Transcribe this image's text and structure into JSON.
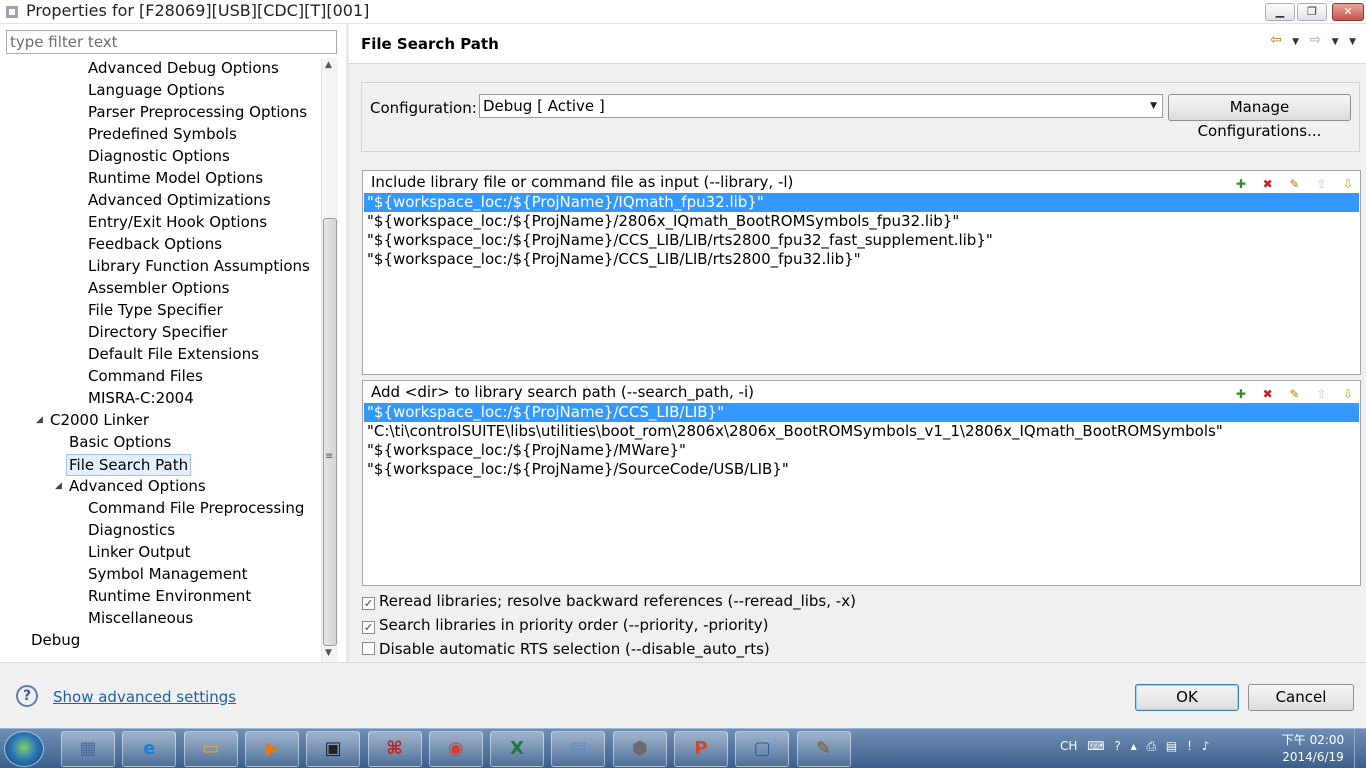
{
  "window": {
    "title": "Properties for [F28069][USB][CDC][T][001]",
    "minimize_glyph": "▁",
    "maximize_glyph": "❐",
    "close_glyph": "✕"
  },
  "filter": {
    "placeholder": "type filter text",
    "value": ""
  },
  "tree": {
    "items": [
      {
        "label": "Advanced Debug Options"
      },
      {
        "label": "Language Options"
      },
      {
        "label": "Parser Preprocessing Options"
      },
      {
        "label": "Predefined Symbols"
      },
      {
        "label": "Diagnostic Options"
      },
      {
        "label": "Runtime Model Options"
      },
      {
        "label": "Advanced Optimizations"
      },
      {
        "label": "Entry/Exit Hook Options"
      },
      {
        "label": "Feedback Options"
      },
      {
        "label": "Library Function Assumptions"
      },
      {
        "label": "Assembler Options"
      },
      {
        "label": "File Type Specifier"
      },
      {
        "label": "Directory Specifier"
      },
      {
        "label": "Default File Extensions"
      },
      {
        "label": "Command Files"
      },
      {
        "label": "MISRA-C:2004"
      },
      {
        "label": "C2000 Linker",
        "expanded": true
      },
      {
        "label": "Basic Options"
      },
      {
        "label": "File Search Path",
        "selected": true
      },
      {
        "label": "Advanced Options",
        "expanded": true
      },
      {
        "label": "Command File Preprocessing"
      },
      {
        "label": "Diagnostics"
      },
      {
        "label": "Linker Output"
      },
      {
        "label": "Symbol Management"
      },
      {
        "label": "Runtime Environment"
      },
      {
        "label": "Miscellaneous"
      },
      {
        "label": "Debug"
      }
    ],
    "expand_glyph": "◢"
  },
  "page": {
    "title": "File Search Path",
    "nav": {
      "back": "⇦",
      "dropdown": "▼",
      "forward": "⇨"
    }
  },
  "configuration": {
    "label": "Configuration:",
    "selected": "Debug  [ Active ]",
    "manage_button": "Manage Configurations..."
  },
  "libraries": {
    "title": "Include library file or command file as input (--library, -l)",
    "items": [
      "\"${workspace_loc:/${ProjName}/IQmath_fpu32.lib}\"",
      "\"${workspace_loc:/${ProjName}/2806x_IQmath_BootROMSymbols_fpu32.lib}\"",
      "\"${workspace_loc:/${ProjName}/CCS_LIB/LIB/rts2800_fpu32_fast_supplement.lib}\"",
      "\"${workspace_loc:/${ProjName}/CCS_LIB/LIB/rts2800_fpu32.lib}\""
    ],
    "selected_index": 0
  },
  "search_paths": {
    "title": "Add <dir> to library search path (--search_path, -i)",
    "items": [
      "\"${workspace_loc:/${ProjName}/CCS_LIB/LIB}\"",
      "\"C:\\ti\\controlSUITE\\libs\\utilities\\boot_rom\\2806x\\2806x_BootROMSymbols_v1_1\\2806x_IQmath_BootROMSymbols\"",
      "\"${workspace_loc:/${ProjName}/MWare}\"",
      "\"${workspace_loc:/${ProjName}/SourceCode/USB/LIB}\""
    ],
    "selected_index": 0
  },
  "tool_icons": {
    "add": "✚",
    "delete": "✖",
    "edit": "✎",
    "up": "⇧",
    "down": "⇩"
  },
  "options": [
    {
      "label": "Reread libraries; resolve backward references (--reread_libs, -x)",
      "checked": true,
      "mark": "✓"
    },
    {
      "label": "Search libraries in priority order (--priority, -priority)",
      "checked": true,
      "mark": "✓"
    },
    {
      "label": "Disable automatic RTS selection (--disable_auto_rts)",
      "checked": false,
      "mark": ""
    }
  ],
  "footer": {
    "help_glyph": "?",
    "advanced_link": "Show advanced settings",
    "ok": "OK",
    "cancel": "Cancel"
  },
  "taskbar": {
    "apps": [
      {
        "name": "calculator",
        "glyph": "▦",
        "color": "#4a6a9a"
      },
      {
        "name": "internet-explorer",
        "glyph": "e",
        "color": "#1e7fd6"
      },
      {
        "name": "file-explorer",
        "glyph": "▭",
        "color": "#d9a93a"
      },
      {
        "name": "media-player",
        "glyph": "▶",
        "color": "#e07a1a"
      },
      {
        "name": "chip-tool",
        "glyph": "▣",
        "color": "#222222"
      },
      {
        "name": "adobe-reader",
        "glyph": "⌘",
        "color": "#c31d1d"
      },
      {
        "name": "chrome",
        "glyph": "◉",
        "color": "#d43c2e"
      },
      {
        "name": "excel",
        "glyph": "X",
        "color": "#1d7a3c"
      },
      {
        "name": "notepad",
        "glyph": "▤",
        "color": "#5b8fc7"
      },
      {
        "name": "code-composer",
        "glyph": "⬢",
        "color": "#6a6a6a"
      },
      {
        "name": "powerpoint",
        "glyph": "P",
        "color": "#d24726"
      },
      {
        "name": "app-blue",
        "glyph": "▢",
        "color": "#1b5fa3"
      },
      {
        "name": "paint",
        "glyph": "✎",
        "color": "#7a5a2a"
      }
    ],
    "tray": {
      "lang": "CH",
      "icons": [
        "⌨",
        "?",
        "▴",
        "⎙",
        "▤",
        "!",
        "♪"
      ]
    },
    "clock_time": "下午 02:00",
    "clock_date": "2014/6/19"
  }
}
